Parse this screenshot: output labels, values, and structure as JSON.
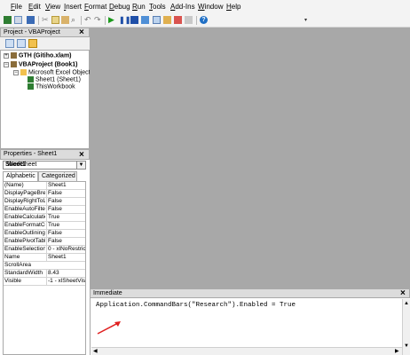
{
  "menubar": {
    "items": [
      "File",
      "Edit",
      "View",
      "Insert",
      "Format",
      "Debug",
      "Run",
      "Tools",
      "Add-Ins",
      "Window",
      "Help"
    ]
  },
  "project": {
    "title": "Project - VBAProject",
    "tree": [
      {
        "label": "GTH (Gitiho.xlam)",
        "bold": true
      },
      {
        "label": "VBAProject (Book1)",
        "bold": true
      },
      {
        "label": "Microsoft Excel Objects",
        "bold": false
      },
      {
        "label": "Sheet1 (Sheet1)",
        "bold": false
      },
      {
        "label": "ThisWorkbook",
        "bold": false
      }
    ]
  },
  "properties": {
    "title": "Properties - Sheet1",
    "object_name": "Sheet1",
    "object_type": "Worksheet",
    "tabs": [
      "Alphabetic",
      "Categorized"
    ],
    "rows": [
      {
        "name": "(Name)",
        "value": "Sheet1"
      },
      {
        "name": "DisplayPageBreak",
        "value": "False"
      },
      {
        "name": "DisplayRightToLef",
        "value": "False"
      },
      {
        "name": "EnableAutoFilter",
        "value": "False"
      },
      {
        "name": "EnableCalculation",
        "value": "True"
      },
      {
        "name": "EnableFormatCon",
        "value": "True"
      },
      {
        "name": "EnableOutlining",
        "value": "False"
      },
      {
        "name": "EnablePivotTable",
        "value": "False"
      },
      {
        "name": "EnableSelection",
        "value": "0 - xlNoRestricti"
      },
      {
        "name": "Name",
        "value": "Sheet1"
      },
      {
        "name": "ScrollArea",
        "value": ""
      },
      {
        "name": "StandardWidth",
        "value": "8.43"
      },
      {
        "name": "Visible",
        "value": "-1 - xlSheetVisib"
      }
    ]
  },
  "immediate": {
    "title": "Immediate",
    "code": "Application.CommandBars(\"Research\").Enabled = True"
  },
  "colors": {
    "main_bg": "#a8a8a8",
    "arrow": "#e02020",
    "selection": "#316ac5"
  }
}
